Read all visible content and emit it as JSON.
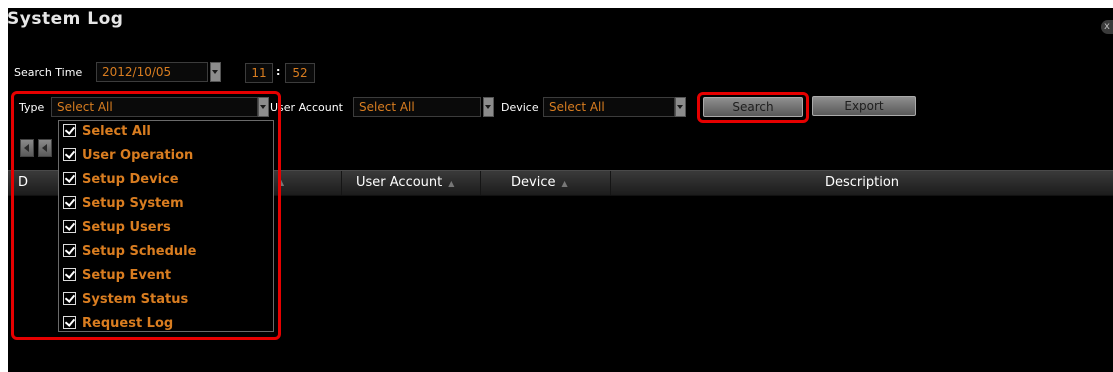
{
  "window": {
    "title": "System Log",
    "close_label": "x"
  },
  "search_time": {
    "label": "Search Time",
    "date": "2012/10/05",
    "hour": "11",
    "minute": "52",
    "separator": ":"
  },
  "filters": {
    "type_label": "Type",
    "type_value": "Select All",
    "user_account_label": "User Account",
    "user_account_value": "Select All",
    "device_label": "Device",
    "device_value": "Select All"
  },
  "buttons": {
    "search": "Search",
    "export": "Export"
  },
  "table": {
    "columns": [
      "D",
      "User Account",
      "Device",
      "Description"
    ]
  },
  "type_dropdown": {
    "options": [
      {
        "label": "Select All",
        "checked": true
      },
      {
        "label": "User Operation",
        "checked": true
      },
      {
        "label": "Setup Device",
        "checked": true
      },
      {
        "label": "Setup System",
        "checked": true
      },
      {
        "label": "Setup Users",
        "checked": true
      },
      {
        "label": "Setup Schedule",
        "checked": true
      },
      {
        "label": "Setup Event",
        "checked": true
      },
      {
        "label": "System Status",
        "checked": true
      },
      {
        "label": "Request Log",
        "checked": true
      }
    ]
  },
  "colors": {
    "accent": "#d97d20",
    "highlight": "#e60000",
    "background": "#000000"
  }
}
